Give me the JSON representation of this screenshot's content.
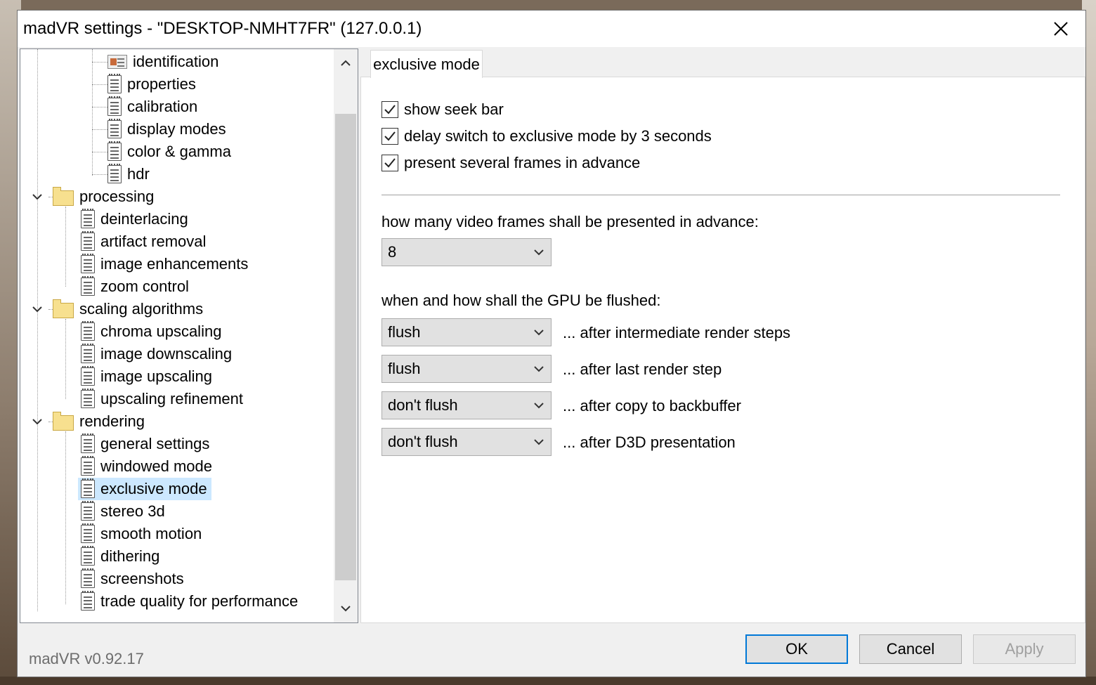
{
  "window": {
    "title": "madVR settings - \"DESKTOP-NMHT7FR\" (127.0.0.1)"
  },
  "tree": {
    "items": [
      {
        "label": "identification",
        "icon": "id-card-icon"
      },
      {
        "label": "properties",
        "icon": "document-icon"
      },
      {
        "label": "calibration",
        "icon": "document-icon"
      },
      {
        "label": "display modes",
        "icon": "document-icon"
      },
      {
        "label": "color & gamma",
        "icon": "document-icon"
      },
      {
        "label": "hdr",
        "icon": "document-icon"
      },
      {
        "label": "processing",
        "icon": "folder-icon"
      },
      {
        "label": "deinterlacing",
        "icon": "document-icon"
      },
      {
        "label": "artifact removal",
        "icon": "document-icon"
      },
      {
        "label": "image enhancements",
        "icon": "document-icon"
      },
      {
        "label": "zoom control",
        "icon": "document-icon"
      },
      {
        "label": "scaling algorithms",
        "icon": "folder-icon"
      },
      {
        "label": "chroma upscaling",
        "icon": "document-icon"
      },
      {
        "label": "image downscaling",
        "icon": "document-icon"
      },
      {
        "label": "image upscaling",
        "icon": "document-icon"
      },
      {
        "label": "upscaling refinement",
        "icon": "document-icon"
      },
      {
        "label": "rendering",
        "icon": "folder-icon"
      },
      {
        "label": "general settings",
        "icon": "document-icon"
      },
      {
        "label": "windowed mode",
        "icon": "document-icon"
      },
      {
        "label": "exclusive mode",
        "icon": "document-icon",
        "selected": true
      },
      {
        "label": "stereo 3d",
        "icon": "document-icon"
      },
      {
        "label": "smooth motion",
        "icon": "document-icon"
      },
      {
        "label": "dithering",
        "icon": "document-icon"
      },
      {
        "label": "screenshots",
        "icon": "document-icon"
      },
      {
        "label": "trade quality for performance",
        "icon": "document-icon"
      }
    ]
  },
  "panel": {
    "tab": "exclusive mode",
    "checkboxes": [
      {
        "label": "show seek bar",
        "checked": true
      },
      {
        "label": "delay switch to exclusive mode by 3 seconds",
        "checked": true
      },
      {
        "label": "present several frames in advance",
        "checked": true
      }
    ],
    "frames_label": "how many video frames shall be presented in advance:",
    "frames_value": "8",
    "flush_label": "when and how shall the GPU be flushed:",
    "flush_rows": [
      {
        "value": "flush",
        "note": "... after intermediate render steps"
      },
      {
        "value": "flush",
        "note": "... after last render step"
      },
      {
        "value": "don't flush",
        "note": "... after copy to backbuffer"
      },
      {
        "value": "don't flush",
        "note": "... after D3D presentation"
      }
    ]
  },
  "footer": {
    "version": "madVR v0.92.17",
    "ok": "OK",
    "cancel": "Cancel",
    "apply": "Apply"
  },
  "colors": {
    "selection": "#cce8ff",
    "accent": "#0078d7"
  }
}
